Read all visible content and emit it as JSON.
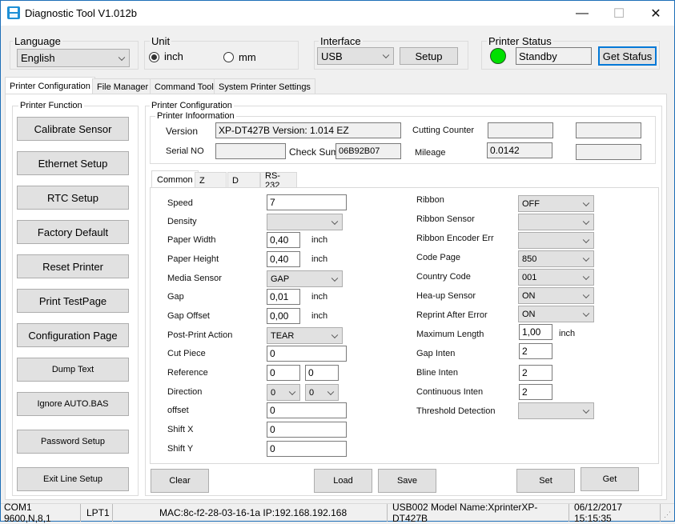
{
  "window": {
    "title": "Diagnostic Tool V1.012b",
    "minimize": "—",
    "maximize": "☐",
    "close": "✕"
  },
  "language": {
    "label": "Language",
    "value": "English"
  },
  "unit": {
    "label": "Unit",
    "options": [
      "inch",
      "mm"
    ],
    "selected": "inch"
  },
  "interface": {
    "label": "Interface",
    "value": "USB",
    "setup_label": "Setup"
  },
  "printer_status": {
    "label": "Printer  Status",
    "value": "Standby",
    "button_label": "Get Stafus",
    "indicator_color": "#00e000"
  },
  "tabs": [
    "Printer Configuration",
    "File Manager",
    "Command Tool",
    "System Printer Settings"
  ],
  "printer_function": {
    "label": "Printer  Function",
    "buttons": [
      "Calibrate Sensor",
      "Ethernet Setup",
      "RTC Setup",
      "Factory Default",
      "Reset Printer",
      "Print TestPage",
      "Configuration Page",
      "Dump Text",
      "Ignore AUTO.BAS",
      "Password Setup",
      "Exit Line Setup"
    ]
  },
  "printer_config": {
    "label": "Printer Configuration",
    "info": {
      "label": "Printer Infoormation",
      "version_label": "Version",
      "version_value": "XP-DT427B Version: 1.014 EZ",
      "serial_label": "Serial NO",
      "serial_value": "",
      "checksum_label": "Check Sum",
      "checksum_value": "06B92B07",
      "cutting_label": "Cutting Counter",
      "cutting_value": "",
      "cutting_value2": "",
      "mileage_label": "Mileage",
      "mileage_value": "0.0142",
      "mileage_value2": ""
    },
    "subtabs": [
      "Common",
      "Z",
      "D",
      "RS-232"
    ],
    "common": {
      "speed": {
        "label": "Speed",
        "value": "7"
      },
      "density": {
        "label": "Density",
        "value": ""
      },
      "paper_width": {
        "label": "Paper Width",
        "value": "0,40",
        "unit": "inch"
      },
      "paper_height": {
        "label": "Paper Height",
        "value": "0,40",
        "unit": "inch"
      },
      "media_sensor": {
        "label": "Media Sensor",
        "value": "GAP"
      },
      "gap": {
        "label": "Gap",
        "value": "0,01",
        "unit": "inch"
      },
      "gap_offset": {
        "label": "Gap Offset",
        "value": "0,00",
        "unit": "inch"
      },
      "post_print": {
        "label": "Post-Print  Action",
        "value": "TEAR"
      },
      "cut_piece": {
        "label": "Cut  Piece",
        "value": "0"
      },
      "reference": {
        "label": "Reference",
        "x": "0",
        "y": "0"
      },
      "direction": {
        "label": "Direction",
        "a": "0",
        "b": "0"
      },
      "offset": {
        "label": "offset",
        "value": "0"
      },
      "shift_x": {
        "label": "Shift X",
        "value": "0"
      },
      "shift_y": {
        "label": "Shift Y",
        "value": "0"
      },
      "ribbon": {
        "label": "Ribbon",
        "value": "OFF"
      },
      "ribbon_sensor": {
        "label": "Ribbon  Sensor",
        "value": ""
      },
      "ribbon_encoder": {
        "label": "Ribbon Encoder Err",
        "value": ""
      },
      "code_page": {
        "label": "Code Page",
        "value": "850"
      },
      "country_code": {
        "label": "Country Code",
        "value": "001"
      },
      "head_up": {
        "label": "Hea-up  Sensor",
        "value": "ON"
      },
      "reprint": {
        "label": "Reprint After  Error",
        "value": "ON"
      },
      "max_length": {
        "label": "Maximum Length",
        "value": "1,00",
        "unit": "inch"
      },
      "gap_inten": {
        "label": "Gap Inten",
        "value": "2"
      },
      "bline_inten": {
        "label": "Bline  Inten",
        "value": "2"
      },
      "cont_inten": {
        "label": "Continuous  Inten",
        "value": "2"
      },
      "threshold": {
        "label": "Threshold  Detection",
        "value": ""
      }
    },
    "actions": {
      "clear": "Clear",
      "load": "Load",
      "save": "Save",
      "set": "Set",
      "get": "Get"
    }
  },
  "statusbar": {
    "com": "COM1 9600,N,8,1",
    "lpt": "LPT1",
    "net": "MAC:8c-f2-28-03-16-1a  IP:192.168.192.168",
    "usb": "USB002  Model Name:XprinterXP-DT427B",
    "datetime": "06/12/2017 15:15:35"
  }
}
